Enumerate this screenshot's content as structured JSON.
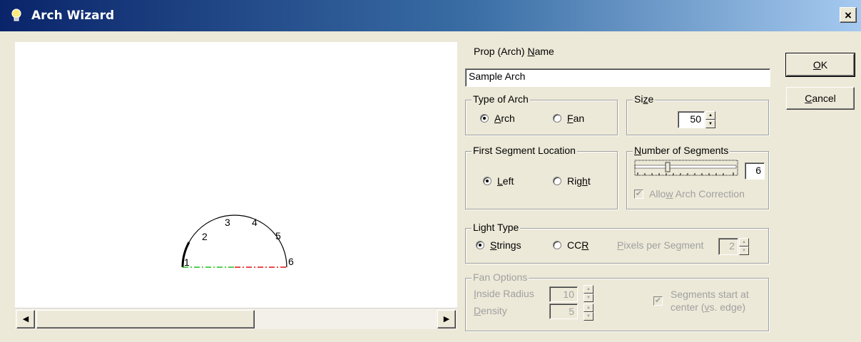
{
  "window": {
    "title": "Arch Wizard",
    "close_glyph": "×"
  },
  "prop_name": {
    "label_pre": "Prop (Arch) ",
    "label_key": "N",
    "label_post": "ame",
    "value": "Sample Arch"
  },
  "type_of_arch": {
    "title": "Type of Arch",
    "options": [
      {
        "key": "A",
        "rest": "rch",
        "selected": true
      },
      {
        "key": "F",
        "rest": "an",
        "selected": false
      }
    ]
  },
  "size": {
    "title_pre": "Si",
    "title_key": "z",
    "title_post": "e",
    "value": "50"
  },
  "first_segment": {
    "title": "First Segment Location",
    "options": [
      {
        "key": "L",
        "rest": "eft",
        "selected": true
      },
      {
        "pre": "Rig",
        "key": "h",
        "rest": "t",
        "selected": false
      }
    ]
  },
  "segments": {
    "title_key": "N",
    "title_rest": "umber of Segments",
    "value": "6",
    "allow_correction_pre": "Allo",
    "allow_correction_key": "w",
    "allow_correction_post": " Arch Correction",
    "allow_correction_checked": true
  },
  "light_type": {
    "title": "Light Type",
    "options": [
      {
        "key": "S",
        "rest": "trings",
        "selected": true
      },
      {
        "pre": "CC",
        "key": "R",
        "rest": "",
        "selected": false
      }
    ],
    "pixels_key": "P",
    "pixels_rest": "ixels per Segment",
    "pixels_value": "2"
  },
  "fan_options": {
    "title": "Fan Options",
    "inside_radius_key": "I",
    "inside_radius_rest": "nside Radius",
    "inside_radius_value": "10",
    "density_key": "D",
    "density_rest": "ensity",
    "density_value": "5",
    "segments_start_line1": "Segments start at",
    "segments_start_line2_pre": "center (",
    "segments_start_line2_key": "v",
    "segments_start_line2_post": "s. edge)"
  },
  "buttons": {
    "ok_key": "O",
    "ok_rest": "K",
    "cancel_key": "C",
    "cancel_rest": "ancel"
  },
  "preview": {
    "segment_labels": [
      "1",
      "2",
      "3",
      "4",
      "5",
      "6"
    ]
  }
}
